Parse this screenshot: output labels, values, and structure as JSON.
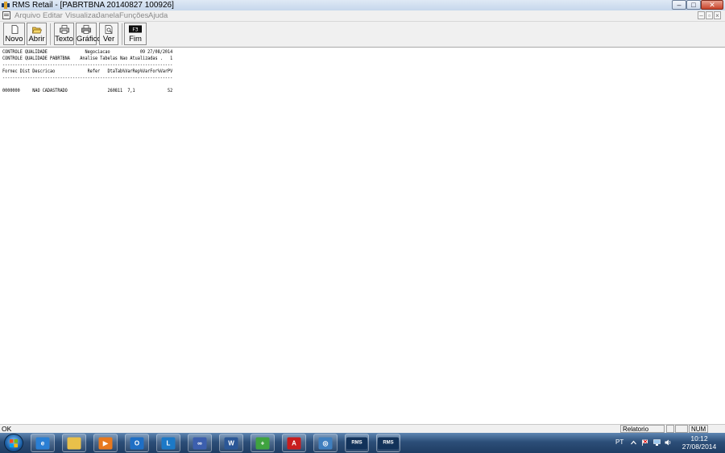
{
  "window": {
    "title": "RMS Retail - [PABRTBNA 20140827 100926]",
    "controls": {
      "minimize": "–",
      "maximize": "□",
      "close": "✕"
    }
  },
  "menu": {
    "items": [
      "Arquivo",
      "Editar",
      "Visualizar",
      "Janela",
      "Funções",
      "Ajuda"
    ],
    "mdi_controls": {
      "minimize": "–",
      "restore": "▫",
      "close": "×"
    }
  },
  "toolbar": {
    "buttons": [
      {
        "label": "Novo",
        "icon": "new-document-icon"
      },
      {
        "label": "Abrir",
        "icon": "open-folder-icon"
      },
      {
        "label": "Texto",
        "icon": "printer-text-icon"
      },
      {
        "label": "Gráfico",
        "icon": "printer-graphic-icon"
      },
      {
        "label": "Ver",
        "icon": "print-preview-icon"
      },
      {
        "label": "Fim",
        "icon": "f3-key-icon",
        "key": "F3"
      }
    ]
  },
  "report": {
    "header_left_1": "CONTROLE QUALIDADE",
    "header_center_1": "Negociacao",
    "header_time": "10:09",
    "header_date": "27/08/2014",
    "header_left_2": "CONTROLE QUALIDADE PABRTBNA",
    "header_center_2": "Analise Tabelas Nao Atualizadas",
    "page_label": "Pg.",
    "page_number": "1",
    "columns": [
      "Fornec",
      "Dist",
      "Descricao",
      "Refer",
      "DtaTab",
      "%VarRep",
      "%VarFor",
      "%VarPV"
    ],
    "rows": [
      {
        "fornec": "0000000",
        "dist": "",
        "descricao": "NAO CADASTRADO",
        "refer": "",
        "dtatab": "260811",
        "varrep": "7,1",
        "varfor": "",
        "varpv": "52"
      }
    ]
  },
  "statusbar": {
    "message": "OK",
    "panel_1": "Relatorio",
    "panel_2": "",
    "panel_3": "",
    "panel_4": "NUM"
  },
  "taskbar": {
    "apps": [
      {
        "name": "internet-explorer",
        "glyph": "e",
        "color": "#2a7fd4"
      },
      {
        "name": "file-explorer",
        "glyph": "",
        "color": "#e9c04a"
      },
      {
        "name": "media-player",
        "glyph": "▶",
        "color": "#e8791e"
      },
      {
        "name": "outlook",
        "glyph": "O",
        "color": "#1f6fc5"
      },
      {
        "name": "lync",
        "glyph": "L",
        "color": "#1c79c7"
      },
      {
        "name": "infinity-app",
        "glyph": "∞",
        "color": "#3c5fae"
      },
      {
        "name": "word",
        "glyph": "W",
        "color": "#2b5797"
      },
      {
        "name": "installer",
        "glyph": "+",
        "color": "#3fa33f"
      },
      {
        "name": "acrobat",
        "glyph": "A",
        "color": "#c81d1d"
      },
      {
        "name": "network-app",
        "glyph": "◎",
        "color": "#3f7fbf"
      },
      {
        "name": "rms-1",
        "glyph": "RMS",
        "color": "#12325a"
      },
      {
        "name": "rms-2",
        "glyph": "RMS",
        "color": "#12325a"
      }
    ],
    "language": "PT",
    "time": "10:12",
    "date": "27/08/2014"
  }
}
